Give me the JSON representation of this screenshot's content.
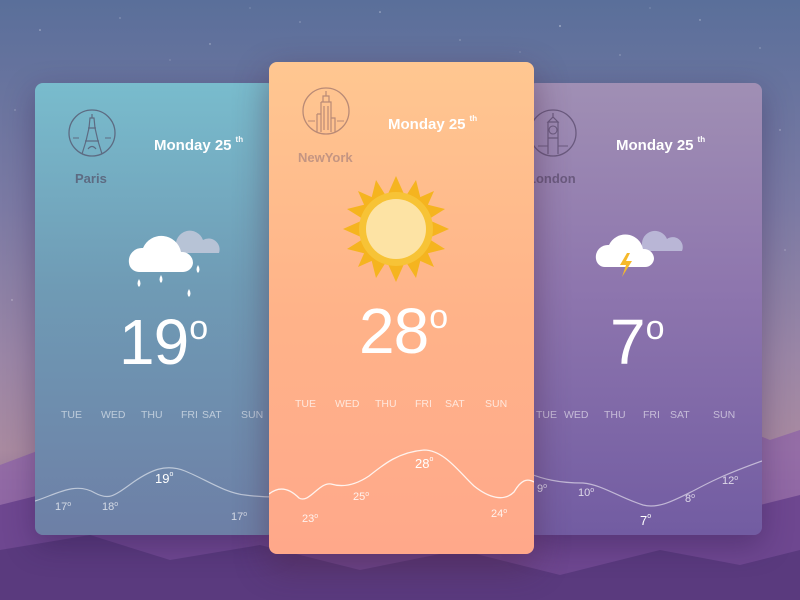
{
  "cards": {
    "paris": {
      "city": "Paris",
      "date": "Monday 25",
      "date_suffix": "th",
      "temp": "19",
      "temp_unit": "o",
      "condition_icon": "rain-cloud-icon",
      "landmark_icon": "eiffel-tower-icon",
      "days": [
        "TUE",
        "WED",
        "THU",
        "FRI",
        "SAT",
        "SUN"
      ],
      "forecast_temps": [
        "17",
        "18",
        "19",
        "17"
      ],
      "forecast_unit": "o",
      "accent": "#79bccd"
    },
    "newyork": {
      "city": "NewYork",
      "date": "Monday 25",
      "date_suffix": "th",
      "temp": "28",
      "temp_unit": "o",
      "condition_icon": "sun-icon",
      "landmark_icon": "skyscraper-icon",
      "days": [
        "TUE",
        "WED",
        "THU",
        "FRI",
        "SAT",
        "SUN"
      ],
      "forecast_temps": [
        "23",
        "25",
        "28",
        "24"
      ],
      "forecast_unit": "o",
      "accent": "#ffc791"
    },
    "london": {
      "city": "London",
      "date": "Monday 25",
      "date_suffix": "th",
      "temp": "7",
      "temp_unit": "o",
      "condition_icon": "thunderstorm-cloud-icon",
      "landmark_icon": "big-ben-icon",
      "days": [
        "TUE",
        "WED",
        "THU",
        "FRI",
        "SAT",
        "SUN"
      ],
      "forecast_temps": [
        "9",
        "10",
        "7",
        "8",
        "12"
      ],
      "forecast_unit": "o",
      "accent": "#8e76ae"
    }
  }
}
